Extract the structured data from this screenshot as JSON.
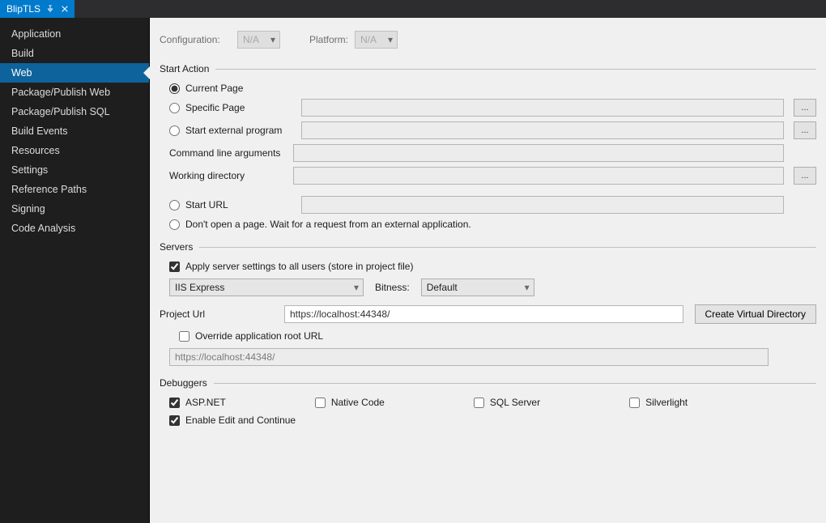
{
  "tab": {
    "title": "BlipTLS"
  },
  "sidebar": {
    "items": [
      {
        "label": "Application"
      },
      {
        "label": "Build"
      },
      {
        "label": "Web",
        "selected": true
      },
      {
        "label": "Package/Publish Web"
      },
      {
        "label": "Package/Publish SQL"
      },
      {
        "label": "Build Events"
      },
      {
        "label": "Resources"
      },
      {
        "label": "Settings"
      },
      {
        "label": "Reference Paths"
      },
      {
        "label": "Signing"
      },
      {
        "label": "Code Analysis"
      }
    ]
  },
  "top": {
    "config_label": "Configuration:",
    "config_value": "N/A",
    "platform_label": "Platform:",
    "platform_value": "N/A"
  },
  "start_action": {
    "title": "Start Action",
    "current_page": "Current Page",
    "specific_page": "Specific Page",
    "start_external": "Start external program",
    "cmd_args_label": "Command line arguments",
    "working_dir_label": "Working directory",
    "start_url_label": "Start URL",
    "dont_open": "Don't open a page.  Wait for a request from an external application.",
    "selected": "current_page"
  },
  "servers": {
    "title": "Servers",
    "apply_all": "Apply server settings to all users (store in project file)",
    "server_dropdown": "IIS Express",
    "bitness_label": "Bitness:",
    "bitness_value": "Default",
    "project_url_label": "Project Url",
    "project_url_value": "https://localhost:44348/",
    "create_vdir": "Create Virtual Directory",
    "override_root_label": "Override application root URL",
    "override_root_value": "https://localhost:44348/"
  },
  "debuggers": {
    "title": "Debuggers",
    "aspnet": "ASP.NET",
    "native": "Native Code",
    "sql": "SQL Server",
    "silverlight": "Silverlight",
    "edit_continue": "Enable Edit and Continue"
  },
  "btn": {
    "ellipsis": "..."
  }
}
